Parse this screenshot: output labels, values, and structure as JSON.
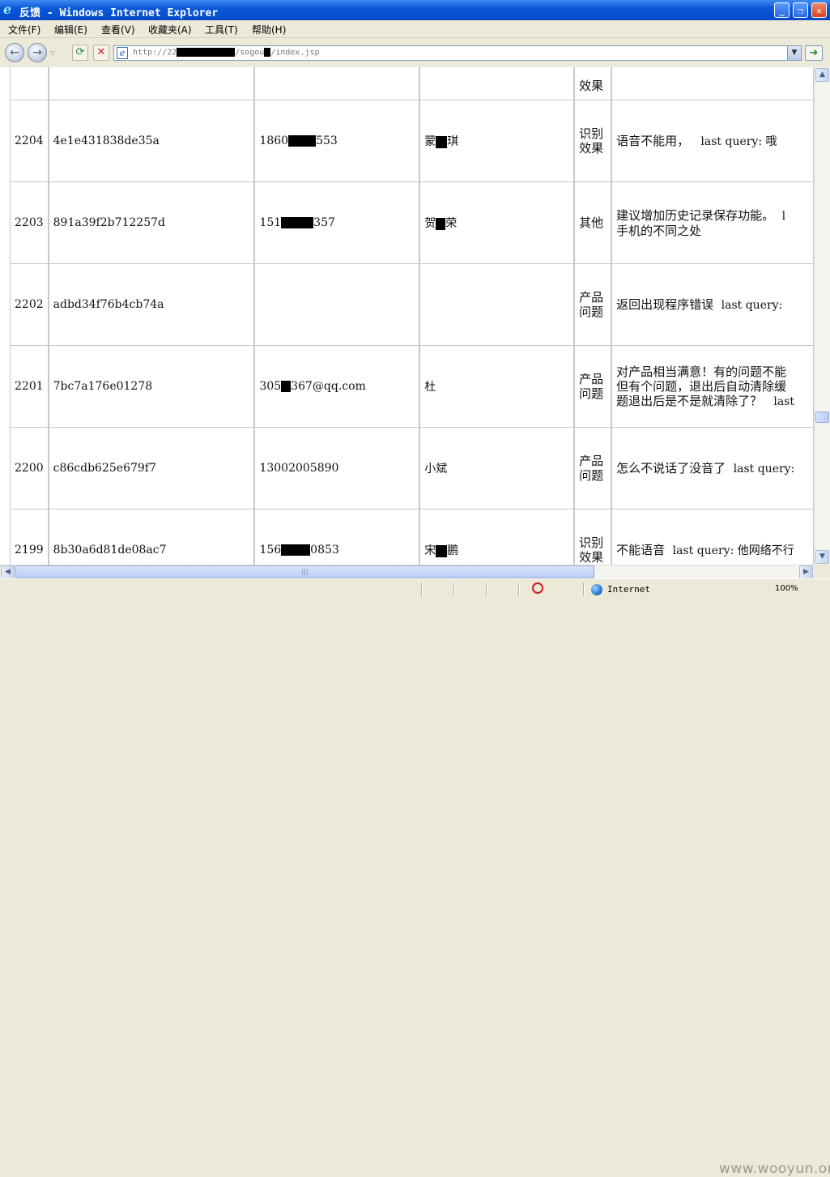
{
  "window": {
    "title": "反馈 - Windows Internet Explorer",
    "minimize_glyph": "_",
    "maximize_glyph": "❐",
    "close_glyph": "✕"
  },
  "menu": {
    "items": [
      "文件(F)",
      "编辑(E)",
      "查看(V)",
      "收藏夹(A)",
      "工具(T)",
      "帮助(H)"
    ]
  },
  "address_bar": {
    "url_prefix": "http://22",
    "url_middle": "/sogou",
    "url_suffix": "/index.jsp",
    "go_glyph": "➜",
    "dropdown_glyph": "▼"
  },
  "nav": {
    "back_glyph": "←",
    "forward_glyph": "→",
    "refresh_glyph": "⟳",
    "stop_glyph": "✕",
    "dropdown_glyph": "▽"
  },
  "table": {
    "top_partial_category": "效果",
    "rows": [
      {
        "id": "2204",
        "hash": "4e1e431838de35a",
        "contact_a": "1860",
        "contact_b": "553",
        "name_a": "蒙",
        "name_b": "琪",
        "category": "识别效果",
        "feedback_lines": [
          [
            "语音不能用，",
            "last query: 哦"
          ]
        ]
      },
      {
        "id": "2203",
        "hash": "891a39f2b712257d",
        "contact_a": "151",
        "contact_b": "357",
        "name_a": "贺",
        "name_b": "荣",
        "category": "其他",
        "feedback_lines": [
          [
            "建议增加历史记录保存功能。",
            "l"
          ],
          [
            "手机的不同之处",
            ""
          ]
        ]
      },
      {
        "id": "2202",
        "hash": "adbd34f76b4cb74a",
        "contact_a": "",
        "contact_b": "",
        "name_a": "",
        "name_b": "",
        "category": "产品问题",
        "feedback_lines": [
          [
            "返回出现程序错误",
            "last query:"
          ]
        ]
      },
      {
        "id": "2201",
        "hash": "7bc7a176e01278",
        "contact_a": "305",
        "contact_b": "367@qq.com",
        "name_a": "杜",
        "name_b": "",
        "category": "产品问题",
        "feedback_lines": [
          [
            "对产品相当满意！有的问题不能",
            ""
          ],
          [
            "但有个问题，退出后自动清除缓",
            ""
          ],
          [
            "题退出后是不是就清除了？",
            "last"
          ]
        ]
      },
      {
        "id": "2200",
        "hash": "c86cdb625e679f7",
        "contact_a": "13002005890",
        "contact_b": "",
        "name_a": "小斌",
        "name_b": "",
        "category": "产品问题",
        "feedback_lines": [
          [
            "怎么不说话了没音了",
            "last query:"
          ]
        ]
      },
      {
        "id": "2199",
        "hash": "8b30a6d81de08ac7",
        "contact_a": "156",
        "contact_b": "0853",
        "name_a": "宋",
        "name_b": "鹏",
        "category": "识别效果",
        "feedback_lines": [
          [
            "不能语音",
            "last query: 他网络不行"
          ]
        ]
      }
    ]
  },
  "status": {
    "zone": "Internet",
    "zoom": "100%",
    "watermark": "www.wooyun.org"
  },
  "colors": {
    "titlebar": "#0a58d8",
    "chrome": "#ece9d8",
    "cell_border": "#c8c8c8"
  }
}
